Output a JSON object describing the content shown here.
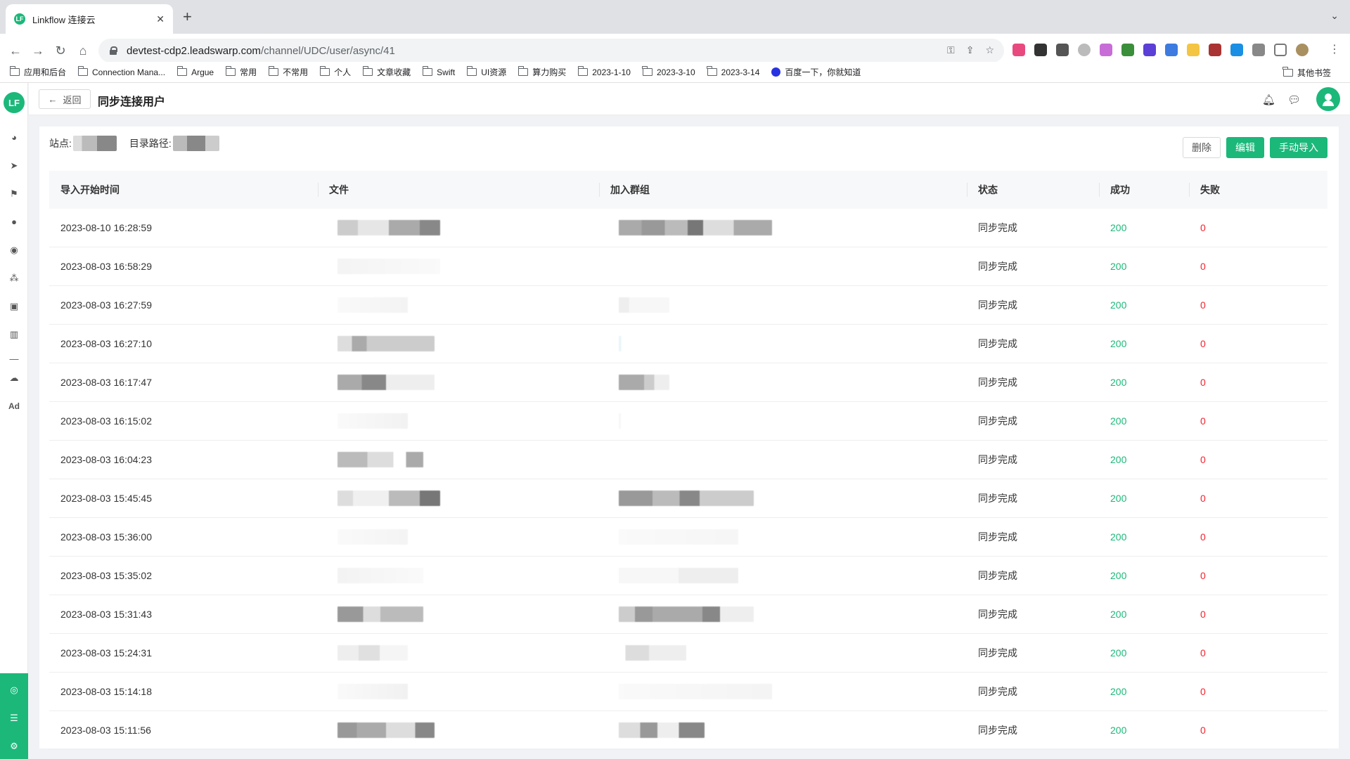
{
  "browser": {
    "tab_title": "Linkflow 连接云",
    "tab_favicon": "LF",
    "new_tab": "+",
    "url_host": "devtest-cdp2.leadswarp.com",
    "url_path": "/channel/UDC/user/async/41",
    "bookmarks": [
      "应用和后台",
      "Connection Mana...",
      "Argue",
      "常用",
      "不常用",
      "个人",
      "文章收藏",
      "Swift",
      "UI资源",
      "算力购买",
      "2023-1-10",
      "2023-3-10",
      "2023-3-14",
      "百度一下，你就知道"
    ],
    "other_bookmarks": "其他书签"
  },
  "app": {
    "logo": "LF",
    "back_label": "返回",
    "page_title": "同步连接用户",
    "site_label": "站点:",
    "path_label": "目录路径:",
    "actions": {
      "delete": "删除",
      "edit": "编辑",
      "manual_import": "手动导入"
    },
    "columns": [
      "导入开始时间",
      "文件",
      "加入群组",
      "状态",
      "成功",
      "失败"
    ],
    "rows": [
      {
        "time": "2023-08-10 16:28:59",
        "status": "同步完成",
        "success": "200",
        "fail": "0"
      },
      {
        "time": "2023-08-03 16:58:29",
        "status": "同步完成",
        "success": "200",
        "fail": "0"
      },
      {
        "time": "2023-08-03 16:27:59",
        "status": "同步完成",
        "success": "200",
        "fail": "0"
      },
      {
        "time": "2023-08-03 16:27:10",
        "status": "同步完成",
        "success": "200",
        "fail": "0"
      },
      {
        "time": "2023-08-03 16:17:47",
        "status": "同步完成",
        "success": "200",
        "fail": "0"
      },
      {
        "time": "2023-08-03 16:15:02",
        "status": "同步完成",
        "success": "200",
        "fail": "0"
      },
      {
        "time": "2023-08-03 16:04:23",
        "status": "同步完成",
        "success": "200",
        "fail": "0"
      },
      {
        "time": "2023-08-03 15:45:45",
        "status": "同步完成",
        "success": "200",
        "fail": "0"
      },
      {
        "time": "2023-08-03 15:36:00",
        "status": "同步完成",
        "success": "200",
        "fail": "0"
      },
      {
        "time": "2023-08-03 15:35:02",
        "status": "同步完成",
        "success": "200",
        "fail": "0"
      },
      {
        "time": "2023-08-03 15:31:43",
        "status": "同步完成",
        "success": "200",
        "fail": "0"
      },
      {
        "time": "2023-08-03 15:24:31",
        "status": "同步完成",
        "success": "200",
        "fail": "0"
      },
      {
        "time": "2023-08-03 15:14:18",
        "status": "同步完成",
        "success": "200",
        "fail": "0"
      },
      {
        "time": "2023-08-03 15:11:56",
        "status": "同步完成",
        "success": "200",
        "fail": "0"
      }
    ]
  },
  "colors": {
    "accent": "#1bb87a",
    "fail": "#f5222d"
  }
}
